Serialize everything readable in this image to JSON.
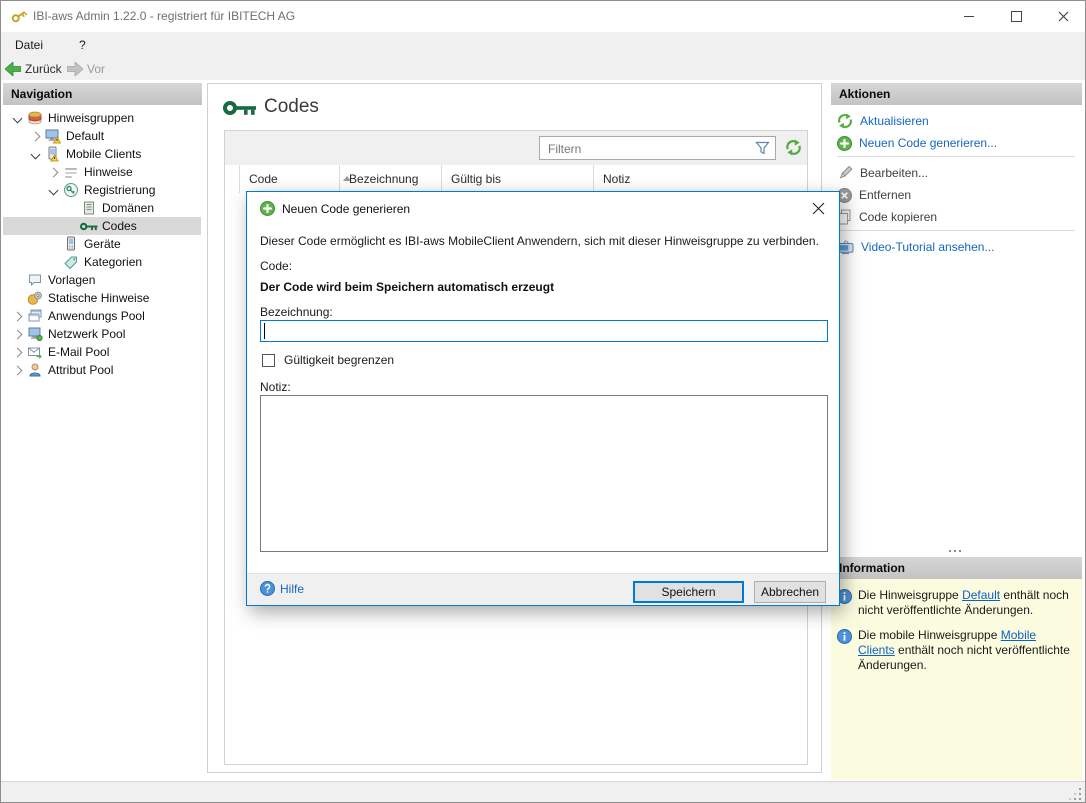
{
  "window": {
    "title": "IBI-aws Admin 1.22.0 - registriert für IBITECH AG"
  },
  "menubar": {
    "items": [
      {
        "label": "Datei"
      },
      {
        "label": "?"
      }
    ]
  },
  "toolbar": {
    "back_label": "Zurück",
    "forward_label": "Vor"
  },
  "navigation": {
    "header": "Navigation",
    "tree": [
      {
        "label": "Hinweisgruppen",
        "icon": "notice-groups-icon",
        "state": "expanded"
      },
      {
        "label": "Default",
        "icon": "monitor-warning-icon",
        "state": "collapsed"
      },
      {
        "label": "Mobile Clients",
        "icon": "mobile-warning-icon",
        "state": "expanded"
      },
      {
        "label": "Hinweise",
        "icon": "notices-icon",
        "state": "collapsed"
      },
      {
        "label": "Registrierung",
        "icon": "registration-icon",
        "state": "expanded"
      },
      {
        "label": "Domänen",
        "icon": "domain-icon"
      },
      {
        "label": "Codes",
        "icon": "key-icon",
        "selected": true
      },
      {
        "label": "Geräte",
        "icon": "device-icon"
      },
      {
        "label": "Kategorien",
        "icon": "tag-icon"
      },
      {
        "label": "Vorlagen",
        "icon": "template-icon"
      },
      {
        "label": "Statische Hinweise",
        "icon": "static-notices-icon"
      },
      {
        "label": "Anwendungs Pool",
        "icon": "application-pool-icon",
        "state": "collapsed"
      },
      {
        "label": "Netzwerk Pool",
        "icon": "network-pool-icon",
        "state": "collapsed"
      },
      {
        "label": "E-Mail Pool",
        "icon": "email-pool-icon",
        "state": "collapsed"
      },
      {
        "label": "Attribut Pool",
        "icon": "attribute-pool-icon",
        "state": "collapsed"
      }
    ]
  },
  "content": {
    "title": "Codes",
    "filter_placeholder": "Filtern",
    "table": {
      "columns": [
        "Code",
        "Bezeichnung",
        "Gültig bis",
        "Notiz"
      ],
      "sorted_column": "Code",
      "sort_direction": "ascending",
      "rows": []
    }
  },
  "dialog": {
    "title": "Neuen Code generieren",
    "description": "Dieser Code ermöglicht es IBI-aws MobileClient Anwendern, sich mit dieser Hinweisgruppe zu verbinden.",
    "code_label": "Code:",
    "code_note": "Der Code wird beim Speichern automatisch erzeugt",
    "name_label": "Bezeichnung:",
    "name_value": "",
    "validity_checkbox_label": "Gültigkeit begrenzen",
    "validity_checked": false,
    "note_label": "Notiz:",
    "note_value": "",
    "help_label": "Hilfe",
    "save_label": "Speichern",
    "cancel_label": "Abbrechen"
  },
  "actions": {
    "header": "Aktionen",
    "items": [
      {
        "label": "Aktualisieren",
        "icon": "refresh-icon",
        "enabled": true
      },
      {
        "label": "Neuen Code generieren...",
        "icon": "plus-circle-icon",
        "enabled": true
      },
      {
        "label": "Bearbeiten...",
        "icon": "pencil-icon",
        "enabled": false
      },
      {
        "label": "Entfernen",
        "icon": "remove-circle-icon",
        "enabled": false
      },
      {
        "label": "Code kopieren",
        "icon": "copy-icon",
        "enabled": false
      },
      {
        "label": "Video-Tutorial ansehen...",
        "icon": "tv-icon",
        "enabled": true
      }
    ]
  },
  "information": {
    "header": "Information",
    "items": [
      {
        "prefix": "Die Hinweisgruppe ",
        "link": "Default",
        "suffix": " enthält noch nicht veröffentlichte Änderungen."
      },
      {
        "prefix": "Die mobile Hinweisgruppe ",
        "link": "Mobile Clients",
        "suffix": " enthält noch nicht veröffentlichte Änderungen."
      }
    ]
  },
  "colors": {
    "accent_blue": "#0078d7",
    "link_blue": "#1766c0",
    "key_green": "#176b3f",
    "refresh_green": "#56ab43",
    "info_panel_bg": "#fbfbdf",
    "panel_header_bg": "#c9c9c9",
    "warning_yellow": "#ffd23e"
  }
}
